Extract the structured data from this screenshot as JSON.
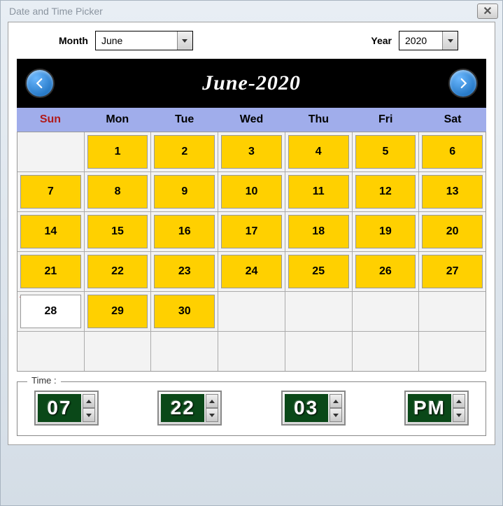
{
  "window": {
    "title": "Date and Time Picker"
  },
  "selectors": {
    "month_label": "Month",
    "month_value": "June",
    "year_label": "Year",
    "year_value": "2020"
  },
  "calendar": {
    "title": "June-2020",
    "day_labels": [
      "Sun",
      "Mon",
      "Tue",
      "Wed",
      "Thu",
      "Fri",
      "Sat"
    ],
    "first_day_offset": 1,
    "days_in_month": 30,
    "today": 28,
    "total_cells": 42
  },
  "time": {
    "legend": "Time :",
    "hour": "07",
    "minute": "22",
    "second": "03",
    "ampm": "PM"
  }
}
